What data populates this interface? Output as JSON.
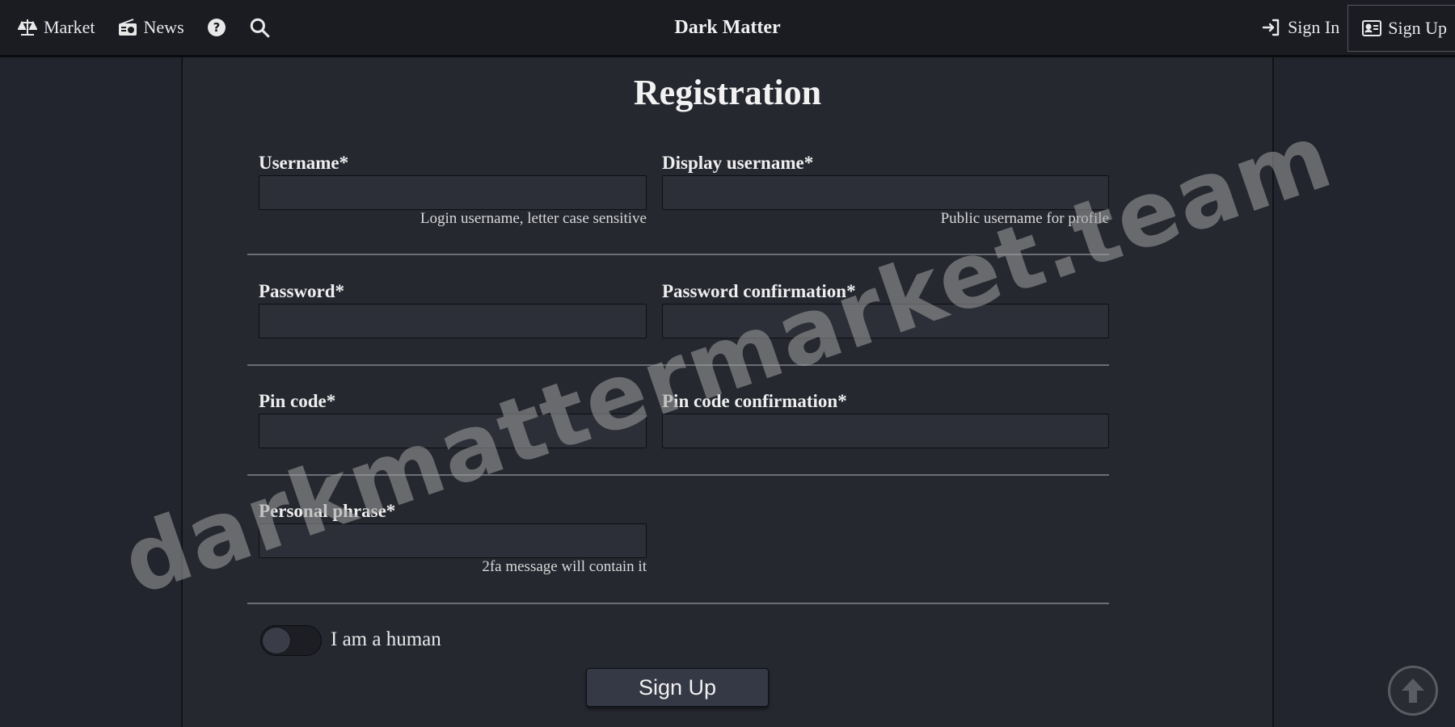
{
  "nav": {
    "market_label": "Market",
    "news_label": "News",
    "brand": "Dark Matter",
    "sign_in_label": "Sign In",
    "sign_up_label": "Sign Up",
    "icons": [
      "scales-icon",
      "radio-icon",
      "help-icon",
      "search-icon",
      "sign-in-icon",
      "id-card-icon"
    ]
  },
  "form": {
    "title": "Registration",
    "username": {
      "label": "Username*",
      "value": "",
      "hint": "Login username, letter case sensitive"
    },
    "display_username": {
      "label": "Display username*",
      "value": "",
      "hint": "Public username for profile"
    },
    "password": {
      "label": "Password*",
      "value": ""
    },
    "password_confirmation": {
      "label": "Password confirmation*",
      "value": ""
    },
    "pin_code": {
      "label": "Pin code*",
      "value": ""
    },
    "pin_code_confirmation": {
      "label": "Pin code confirmation*",
      "value": ""
    },
    "personal_phrase": {
      "label": "Personal phrase*",
      "value": "",
      "hint": "2fa message will contain it"
    },
    "human_check": {
      "label": "I am a human",
      "checked": false
    },
    "submit_label": "Sign Up"
  },
  "watermark": "darkmattermarket.team",
  "colors": {
    "background": "#23252e",
    "topbar": "#1a1c22",
    "card": "#262830",
    "input": "#2d2f38",
    "text": "#e8e8e8"
  }
}
